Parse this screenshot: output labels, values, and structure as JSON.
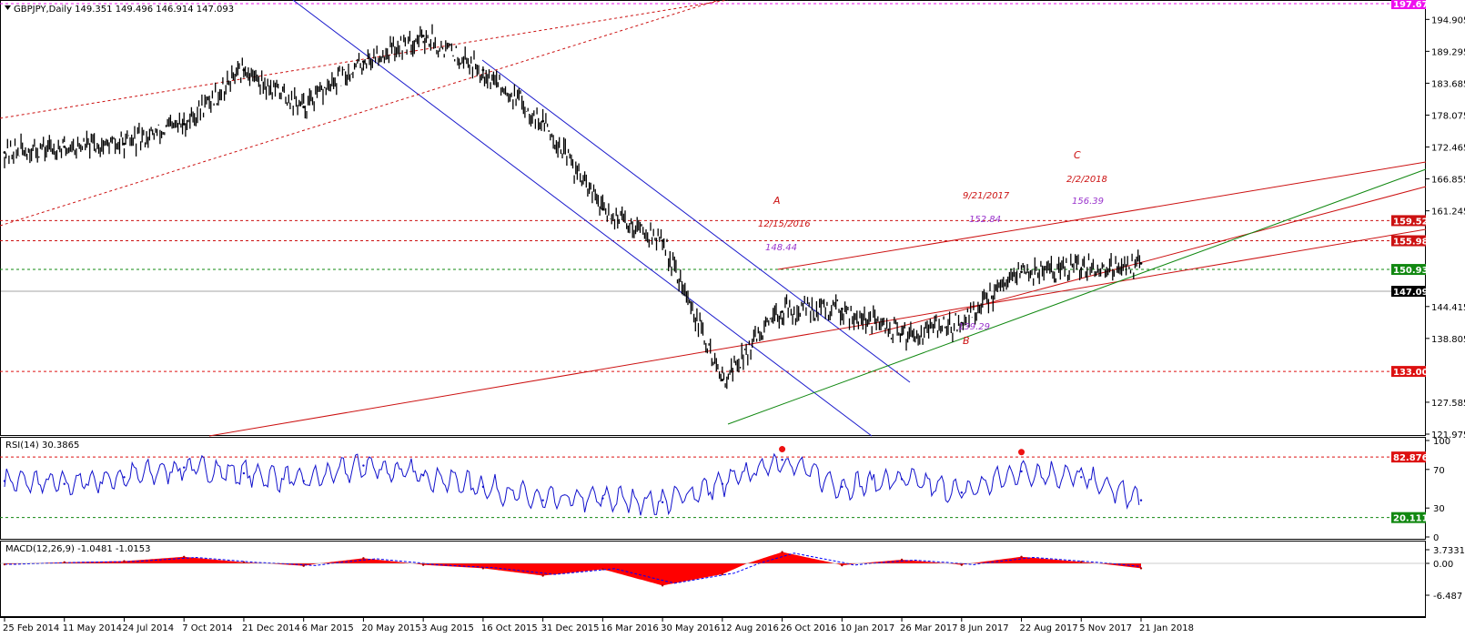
{
  "header": {
    "symbol_line": "GBPJPY,Daily  149.351 149.496 146.914 147.093"
  },
  "colors": {
    "price": "#000000",
    "channel_blue": "#1a1acc",
    "channel_red": "#cc1111",
    "support_green": "#118811",
    "label_purple": "#9933cc",
    "rsi_line": "#1111cc",
    "macd_hist": "#ff0000",
    "macd_signal": "#0000ff",
    "level_magenta": "#ee11ee"
  },
  "chart_data": [
    {
      "type": "line",
      "name": "price_panel",
      "ylim": [
        121.975,
        197.677
      ],
      "y_ticks": [
        "194.905",
        "189.295",
        "183.685",
        "178.075",
        "172.465",
        "166.855",
        "161.245",
        "144.415",
        "138.805",
        "127.585",
        "121.975"
      ],
      "x_ticks": [
        "25 Feb 2014",
        "11 May 2014",
        "24 Jul 2014",
        "7 Oct 2014",
        "21 Dec 2014",
        "6 Mar 2015",
        "20 May 2015",
        "3 Aug 2015",
        "16 Oct 2015",
        "31 Dec 2015",
        "16 Mar 2016",
        "30 May 2016",
        "12 Aug 2016",
        "26 Oct 2016",
        "10 Jan 2017",
        "26 Mar 2017",
        "8 Jun 2017",
        "22 Aug 2017",
        "5 Nov 2017",
        "21 Jan 2018"
      ],
      "series": [
        {
          "x": [
            "25 Feb 2014",
            "11 May 2014",
            "24 Jul 2014",
            "7 Oct 2014",
            "21 Dec 2014",
            "6 Mar 2015",
            "20 May 2015",
            "3 Aug 2015",
            "16 Oct 2015",
            "31 Dec 2015",
            "16 Mar 2016",
            "30 May 2016",
            "12 Aug 2016",
            "26 Oct 2016",
            "10 Jan 2017",
            "26 Mar 2017",
            "8 Jun 2017",
            "22 Aug 2017",
            "5 Nov 2017",
            "21 Jan 2018"
          ],
          "values": [
            171.5,
            172.5,
            173.0,
            176.5,
            186.0,
            179.5,
            187.5,
            192.0,
            186.0,
            177.0,
            161.5,
            156.0,
            131.5,
            143.5,
            144.0,
            139.5,
            141.5,
            150.5,
            151.0,
            152.0
          ]
        }
      ],
      "horizontal_levels": [
        {
          "value": 197.677,
          "label": "197.677",
          "color": "#ee11ee"
        },
        {
          "value": 159.52,
          "label": "159.520",
          "color": "#cc1111"
        },
        {
          "value": 155.981,
          "label": "155.981",
          "color": "#cc1111"
        },
        {
          "value": 150.935,
          "label": "150.935",
          "color": "#118811"
        },
        {
          "value": 147.093,
          "label": "147.093",
          "color": "#000000"
        },
        {
          "value": 133.004,
          "label": "133.004",
          "color": "#dd1111"
        }
      ],
      "annotations": [
        {
          "text": "A",
          "color": "#cc1111"
        },
        {
          "text": "12/15/2016",
          "color": "#cc1111"
        },
        {
          "text": "148.44",
          "color": "#9933cc"
        },
        {
          "text": "9/21/2017",
          "color": "#cc1111"
        },
        {
          "text": "152.84",
          "color": "#9933cc"
        },
        {
          "text": "C",
          "color": "#cc1111"
        },
        {
          "text": "2/2/2018",
          "color": "#cc1111"
        },
        {
          "text": "156.39",
          "color": "#9933cc"
        },
        {
          "text": "139.29",
          "color": "#9933cc"
        },
        {
          "text": "B",
          "color": "#cc1111"
        }
      ]
    },
    {
      "type": "line",
      "name": "rsi_panel",
      "title": "RSI(14) 30.3865",
      "ylim": [
        0,
        100
      ],
      "y_ticks": [
        "100",
        "70",
        "30",
        "0"
      ],
      "series": [
        {
          "x": [
            "25 Feb 2014",
            "11 May 2014",
            "24 Jul 2014",
            "7 Oct 2014",
            "21 Dec 2014",
            "6 Mar 2015",
            "20 May 2015",
            "3 Aug 2015",
            "16 Oct 2015",
            "31 Dec 2015",
            "16 Mar 2016",
            "30 May 2016",
            "12 Aug 2016",
            "26 Oct 2016",
            "10 Jan 2017",
            "26 Mar 2017",
            "8 Jun 2017",
            "22 Aug 2017",
            "5 Nov 2017",
            "21 Jan 2018"
          ],
          "values": [
            58,
            55,
            62,
            72,
            66,
            58,
            74,
            64,
            52,
            38,
            40,
            36,
            55,
            80,
            52,
            60,
            46,
            68,
            62,
            38
          ]
        }
      ],
      "horizontal_levels": [
        {
          "value": 82.8767,
          "label": "82.8767",
          "color": "#dd1111"
        },
        {
          "value": 20.1117,
          "label": "20.1117",
          "color": "#118811"
        }
      ],
      "markers": [
        {
          "x": "26 Oct 2016",
          "value": 91
        },
        {
          "x": "22 Aug 2017",
          "value": 88
        }
      ]
    },
    {
      "type": "area",
      "name": "macd_panel",
      "title": "MACD(12,26,9) -1.0481 -1.0153",
      "ylim": [
        -6.487,
        3.7331
      ],
      "y_ticks": [
        "3.7331",
        "0.00",
        "-6.487"
      ],
      "series": [
        {
          "name": "histogram",
          "x": [
            "25 Feb 2014",
            "11 May 2014",
            "24 Jul 2014",
            "7 Oct 2014",
            "21 Dec 2014",
            "6 Mar 2015",
            "20 May 2015",
            "3 Aug 2015",
            "16 Oct 2015",
            "31 Dec 2015",
            "16 Mar 2016",
            "30 May 2016",
            "12 Aug 2016",
            "26 Oct 2016",
            "10 Jan 2017",
            "26 Mar 2017",
            "8 Jun 2017",
            "22 Aug 2017",
            "5 Nov 2017",
            "21 Jan 2018"
          ],
          "values": [
            -0.2,
            0.3,
            0.6,
            1.8,
            0.3,
            -0.5,
            1.4,
            -0.3,
            -1.0,
            -2.5,
            -1.2,
            -4.5,
            -2.2,
            3.1,
            -0.4,
            1.0,
            -0.3,
            1.8,
            0.4,
            -1.0
          ]
        }
      ]
    }
  ]
}
